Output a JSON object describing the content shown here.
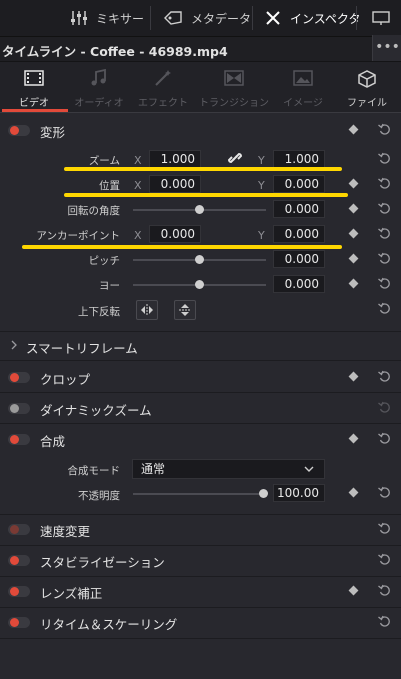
{
  "topbar": {
    "mixer": "ミキサー",
    "metadata": "メタデータ",
    "inspector": "インスペクタ"
  },
  "title": "タイムライン - Coffee - 46989.mp4",
  "more_glyph": "•••",
  "tabs": [
    {
      "label": "ビデオ",
      "icon": "film-icon",
      "state": "active"
    },
    {
      "label": "オーディオ",
      "icon": "music-note-icon",
      "state": "disabled"
    },
    {
      "label": "エフェクト",
      "icon": "magic-wand-icon",
      "state": "disabled"
    },
    {
      "label": "トランジション",
      "icon": "transition-icon",
      "state": "disabled"
    },
    {
      "label": "イメージ",
      "icon": "image-icon",
      "state": "disabled"
    },
    {
      "label": "ファイル",
      "icon": "file-box-icon",
      "state": "enabled"
    }
  ],
  "transform": {
    "label": "変形",
    "zoom": {
      "label": "ズーム",
      "x_axis": "X",
      "x": "1.000",
      "y_axis": "Y",
      "y": "1.000"
    },
    "position": {
      "label": "位置",
      "x_axis": "X",
      "x": "0.000",
      "y_axis": "Y",
      "y": "0.000"
    },
    "rotation": {
      "label": "回転の角度",
      "value": "0.000",
      "slider": 0.5
    },
    "anchor": {
      "label": "アンカーポイント",
      "x_axis": "X",
      "x": "0.000",
      "y_axis": "Y",
      "y": "0.000"
    },
    "pitch": {
      "label": "ピッチ",
      "value": "0.000",
      "slider": 0.5
    },
    "yaw": {
      "label": "ヨー",
      "value": "0.000",
      "slider": 0.5
    },
    "flip": {
      "label": "上下反転"
    }
  },
  "smart_reframe": {
    "label": "スマートリフレーム"
  },
  "crop": {
    "label": "クロップ"
  },
  "dynamic_zoom": {
    "label": "ダイナミックズーム"
  },
  "composite": {
    "label": "合成",
    "mode": {
      "label": "合成モード",
      "value": "通常"
    },
    "opacity": {
      "label": "不透明度",
      "value": "100.00",
      "slider": 1.0
    }
  },
  "speed": {
    "label": "速度変更"
  },
  "stabilization": {
    "label": "スタビライゼーション"
  },
  "lens": {
    "label": "レンズ補正"
  },
  "retime": {
    "label": "リタイム＆スケーリング"
  },
  "colors": {
    "accent": "#e14a3a",
    "highlight": "#ffd700"
  }
}
